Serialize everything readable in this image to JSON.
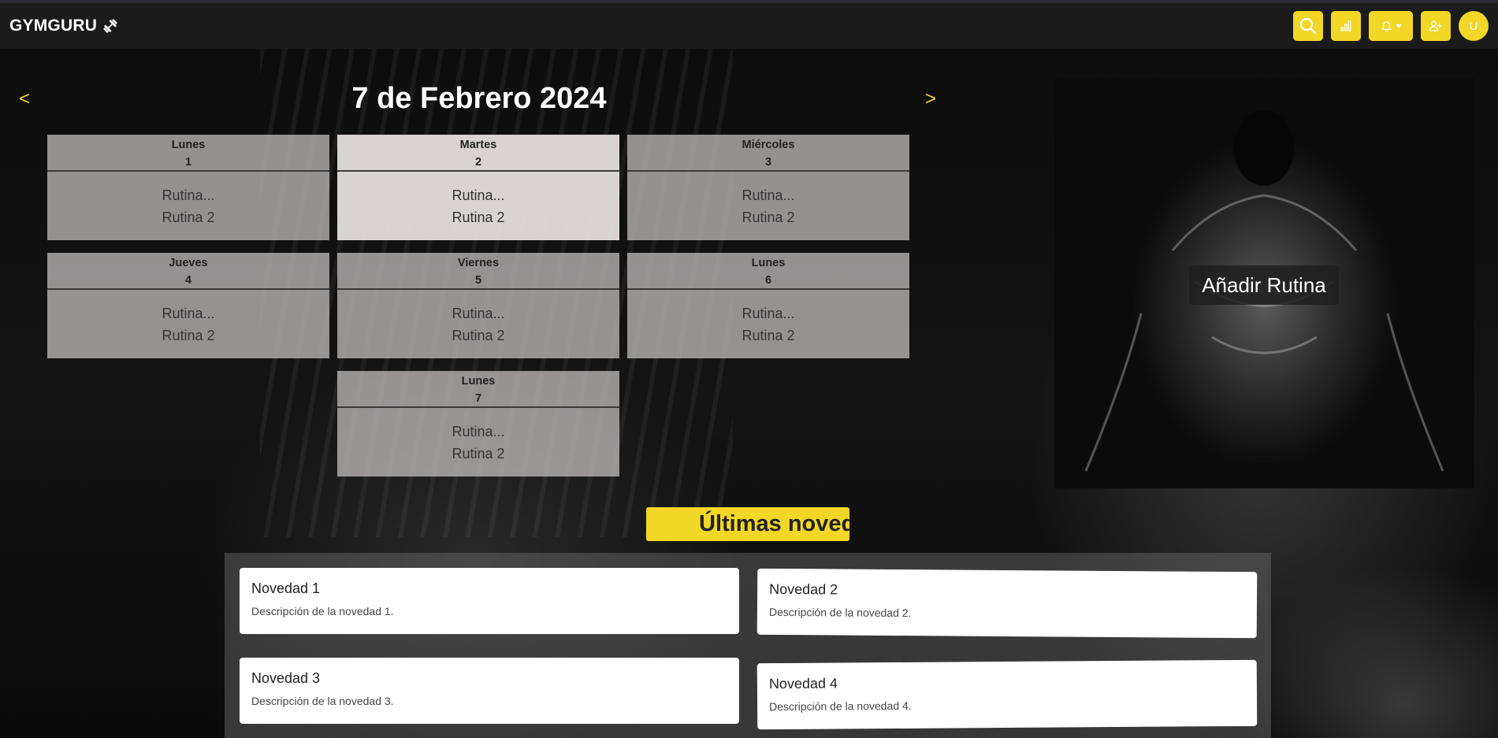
{
  "app": {
    "brand": "GYMGURU"
  },
  "nav": {
    "user_initial": "U"
  },
  "calendar": {
    "prev": "<",
    "next": ">",
    "title": "7 de Febrero 2024",
    "days": [
      {
        "name": "Lunes",
        "num": "1",
        "r1": "Rutina...",
        "r2": "Rutina 2"
      },
      {
        "name": "Martes",
        "num": "2",
        "r1": "Rutina...",
        "r2": "Rutina 2"
      },
      {
        "name": "Miércoles",
        "num": "3",
        "r1": "Rutina...",
        "r2": "Rutina 2"
      },
      {
        "name": "Jueves",
        "num": "4",
        "r1": "Rutina...",
        "r2": "Rutina 2"
      },
      {
        "name": "Viernes",
        "num": "5",
        "r1": "Rutina...",
        "r2": "Rutina 2"
      },
      {
        "name": "Lunes",
        "num": "6",
        "r1": "Rutina...",
        "r2": "Rutina 2"
      },
      {
        "name": "Lunes",
        "num": "7",
        "r1": "Rutina...",
        "r2": "Rutina 2"
      }
    ]
  },
  "routine": {
    "add_label": "Añadir Rutina"
  },
  "news": {
    "title": "Últimas noved",
    "items": [
      {
        "title": "Novedad 1",
        "desc": "Descripción de la novedad 1."
      },
      {
        "title": "Novedad 2",
        "desc": "Descripción de la novedad 2."
      },
      {
        "title": "Novedad 3",
        "desc": "Descripción de la novedad 3."
      },
      {
        "title": "Novedad 4",
        "desc": "Descripción de la novedad 4."
      }
    ]
  },
  "colors": {
    "accent": "#f2d726",
    "navbar": "#1b1b1b"
  }
}
